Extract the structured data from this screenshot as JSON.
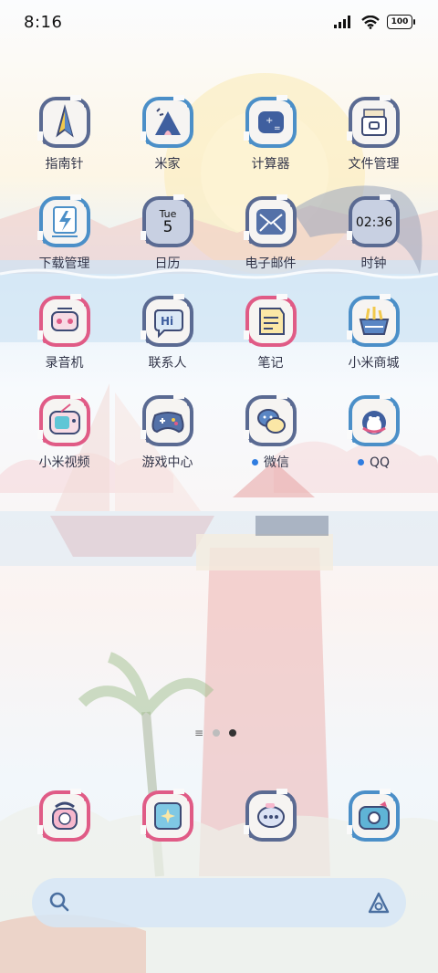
{
  "status_bar": {
    "time": "8:16",
    "battery": "100"
  },
  "apps": [
    {
      "label": "指南针",
      "icon": "compass-icon",
      "frame": "#5a6a92",
      "notify": false
    },
    {
      "label": "米家",
      "icon": "mijia-home-icon",
      "frame": "#4b8fc8",
      "notify": false
    },
    {
      "label": "计算器",
      "icon": "calculator-icon",
      "frame": "#4b8fc8",
      "notify": false
    },
    {
      "label": "文件管理",
      "icon": "folder-icon",
      "frame": "#5a6a92",
      "notify": false
    },
    {
      "label": "下载管理",
      "icon": "download-icon",
      "frame": "#4b8fc8",
      "notify": false
    },
    {
      "label": "日历",
      "icon": "calendar-icon",
      "frame": "#5a6a92",
      "notify": false
    },
    {
      "label": "电子邮件",
      "icon": "mail-icon",
      "frame": "#5a6a92",
      "notify": false
    },
    {
      "label": "时钟",
      "icon": "clock-icon",
      "frame": "#5a6a92",
      "notify": false
    },
    {
      "label": "录音机",
      "icon": "recorder-icon",
      "frame": "#e05b86",
      "notify": false
    },
    {
      "label": "联系人",
      "icon": "contacts-icon",
      "frame": "#5a6a92",
      "notify": false
    },
    {
      "label": "笔记",
      "icon": "notes-icon",
      "frame": "#e05b86",
      "notify": false
    },
    {
      "label": "小米商城",
      "icon": "shop-basket-icon",
      "frame": "#4b8fc8",
      "notify": false
    },
    {
      "label": "小米视频",
      "icon": "tv-icon",
      "frame": "#e05b86",
      "notify": false
    },
    {
      "label": "游戏中心",
      "icon": "gamepad-icon",
      "frame": "#5a6a92",
      "notify": false
    },
    {
      "label": "微信",
      "icon": "wechat-icon",
      "frame": "#5a6a92",
      "notify": true
    },
    {
      "label": "QQ",
      "icon": "qq-penguin-icon",
      "frame": "#4b8fc8",
      "notify": true
    }
  ],
  "calendar": {
    "weekday": "Tue",
    "day": "5"
  },
  "clock_text": "02:36",
  "dock": [
    {
      "icon": "phone-icon",
      "frame": "#e05b86"
    },
    {
      "icon": "gallery-icon",
      "frame": "#e05b86"
    },
    {
      "icon": "messages-icon",
      "frame": "#5a6a92"
    },
    {
      "icon": "camera-icon",
      "frame": "#4b8fc8"
    }
  ],
  "pager": {
    "pages": 2,
    "current": 2
  },
  "search": {
    "placeholder": ""
  },
  "colors": {
    "notify_dot": "#2f7de0",
    "label": "#33364a",
    "search_bg": "#d6e6f6"
  }
}
